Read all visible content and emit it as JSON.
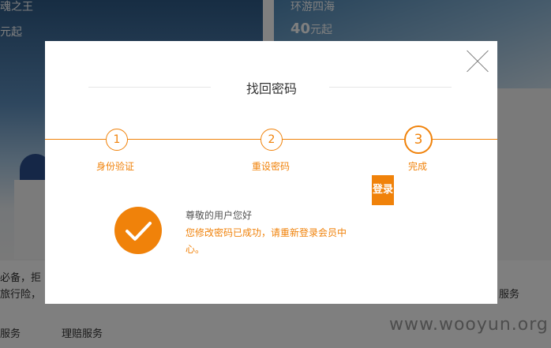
{
  "background": {
    "tile_left_title": "魂之王",
    "tile_left_price": "元起",
    "tile_right_title": "环游四海",
    "tile_right_price_num": "40",
    "tile_right_price_unit": "元起",
    "text_line1": "必备，拒",
    "text_line2": "旅行险，",
    "text_right": "服务",
    "nav_item1": "服务",
    "nav_item2": "理赔服务",
    "watermark": "www.wooyun.org"
  },
  "modal": {
    "title": "找回密码",
    "close_icon": "close-icon",
    "steps": [
      {
        "number": "1",
        "label": "身份验证"
      },
      {
        "number": "2",
        "label": "重设密码"
      },
      {
        "number": "3",
        "label": "完成"
      }
    ],
    "login_button": "登录",
    "success_icon": "checkmark-icon",
    "greeting": "尊敬的用户您好",
    "message": "您修改密码已成功，请重新登录会员中心。"
  },
  "colors": {
    "accent": "#f0820a",
    "overlay": "rgba(0,0,0,0.5)"
  }
}
